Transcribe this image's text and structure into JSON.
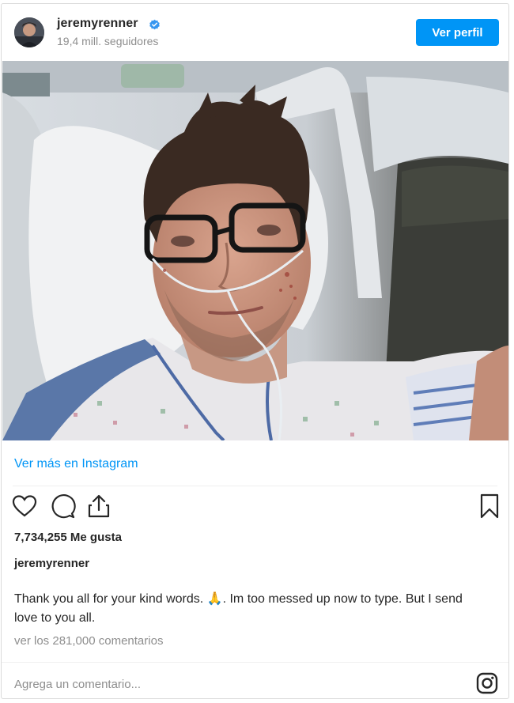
{
  "post": {
    "username": "jeremyrenner",
    "followers": "19,4 mill. seguidores",
    "view_profile_label": "Ver perfil",
    "verified_icon": "verified-badge-icon",
    "photo_description": ""
  },
  "links": {
    "see_more": "Ver más en Instagram"
  },
  "actions": {
    "icons": [
      "heart-icon",
      "comment-icon",
      "share-icon",
      "bookmark-icon"
    ]
  },
  "likes": "7,734,255 Me gusta",
  "caption": {
    "username": "jeremyrenner",
    "text_part1": "Thank you all for your kind words. ",
    "emoji": "🙏",
    "text_part2": ". Im too messed up now to type. But I send love to you all."
  },
  "comments": {
    "view_all": "ver los 281,000 comentarios",
    "placeholder": "Agrega un comentario..."
  },
  "colors": {
    "accent": "#0095f6",
    "muted": "#8e8e8e",
    "text": "#262626"
  }
}
